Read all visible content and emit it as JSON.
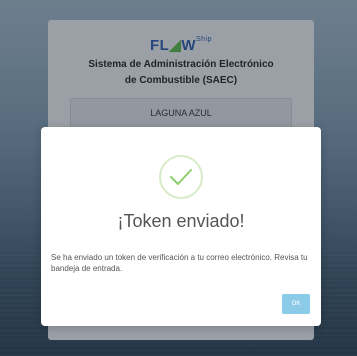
{
  "login": {
    "logo": {
      "part1": "FL",
      "part2": "W",
      "suffix": "Ship"
    },
    "system_title": "Sistema de Administración Electrónico\nde Combustible (SAEC)",
    "station_value": "LAGUNA AZUL"
  },
  "dialog": {
    "title": "¡Token enviado!",
    "message": "Se ha enviado un token de verificación a tu correo electrónico. Revisa tu bandeja de entrada.",
    "ok_label": "OK",
    "icon": "success-check-icon"
  },
  "colors": {
    "check": "#8ccf6e",
    "ok_button": "#8ccbe8",
    "logo": "#2a5aa8"
  }
}
